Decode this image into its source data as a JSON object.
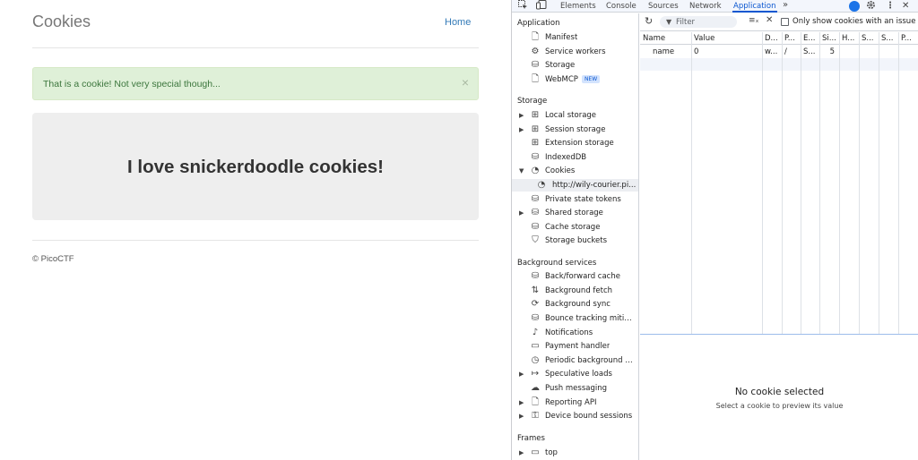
{
  "page": {
    "site_title": "Cookies",
    "home_link": "Home",
    "alert_text": "That is a cookie! Not very special though...",
    "alert_close": "×",
    "jumbotron_text": "I love snickerdoodle cookies!",
    "footer": "© PicoCTF"
  },
  "devtools": {
    "tabs": [
      {
        "label": "Elements",
        "active": false
      },
      {
        "label": "Console",
        "active": false
      },
      {
        "label": "Sources",
        "active": false
      },
      {
        "label": "Network",
        "active": false
      },
      {
        "label": "Application",
        "active": true
      }
    ],
    "more_tabs": "»",
    "sidebar": {
      "application_header": "Application",
      "application_items": [
        {
          "label": "Manifest",
          "icon": "document-icon"
        },
        {
          "label": "Service workers",
          "icon": "gears-icon"
        },
        {
          "label": "Storage",
          "icon": "database-icon"
        },
        {
          "label": "WebMCP",
          "icon": "document-icon",
          "badge": "NEW"
        }
      ],
      "storage_header": "Storage",
      "storage_items": [
        {
          "label": "Local storage",
          "icon": "grid-icon",
          "expandable": true
        },
        {
          "label": "Session storage",
          "icon": "grid-icon",
          "expandable": true
        },
        {
          "label": "Extension storage",
          "icon": "grid-icon"
        },
        {
          "label": "IndexedDB",
          "icon": "database-icon"
        },
        {
          "label": "Cookies",
          "icon": "cookie-icon",
          "expanded": true
        },
        {
          "label": "http://wily-courier.pi...",
          "icon": "cookie-icon",
          "child": true,
          "selected": true
        },
        {
          "label": "Private state tokens",
          "icon": "database-icon"
        },
        {
          "label": "Shared storage",
          "icon": "database-icon",
          "expandable": true
        },
        {
          "label": "Cache storage",
          "icon": "database-icon"
        },
        {
          "label": "Storage buckets",
          "icon": "bucket-icon"
        }
      ],
      "background_header": "Background services",
      "background_items": [
        {
          "label": "Back/forward cache",
          "icon": "database-icon"
        },
        {
          "label": "Background fetch",
          "icon": "updown-arrows-icon"
        },
        {
          "label": "Background sync",
          "icon": "sync-icon"
        },
        {
          "label": "Bounce tracking mitig...",
          "icon": "database-icon"
        },
        {
          "label": "Notifications",
          "icon": "bell-icon"
        },
        {
          "label": "Payment handler",
          "icon": "card-icon"
        },
        {
          "label": "Periodic background s...",
          "icon": "clock-icon"
        },
        {
          "label": "Speculative loads",
          "icon": "arrow-right-icon",
          "expandable": true
        },
        {
          "label": "Push messaging",
          "icon": "cloud-icon"
        },
        {
          "label": "Reporting API",
          "icon": "document-icon",
          "expandable": true
        },
        {
          "label": "Device bound sessions",
          "icon": "lock-icon",
          "expandable": true
        }
      ],
      "frames_header": "Frames",
      "frames_items": [
        {
          "label": "top",
          "icon": "frame-icon",
          "expandable": true
        }
      ]
    },
    "filter": {
      "placeholder": "Filter",
      "only_issue_label": "Only show cookies with an issue"
    },
    "table": {
      "headers": [
        "Name",
        "Value",
        "D...",
        "P...",
        "E...",
        "Si...",
        "H...",
        "S...",
        "S...",
        "P..."
      ],
      "rows": [
        [
          "name",
          "0",
          "w...",
          "/",
          "S...",
          "5",
          "",
          "",
          "",
          ""
        ]
      ]
    },
    "preview": {
      "title": "No cookie selected",
      "subtitle": "Select a cookie to preview its value"
    }
  }
}
